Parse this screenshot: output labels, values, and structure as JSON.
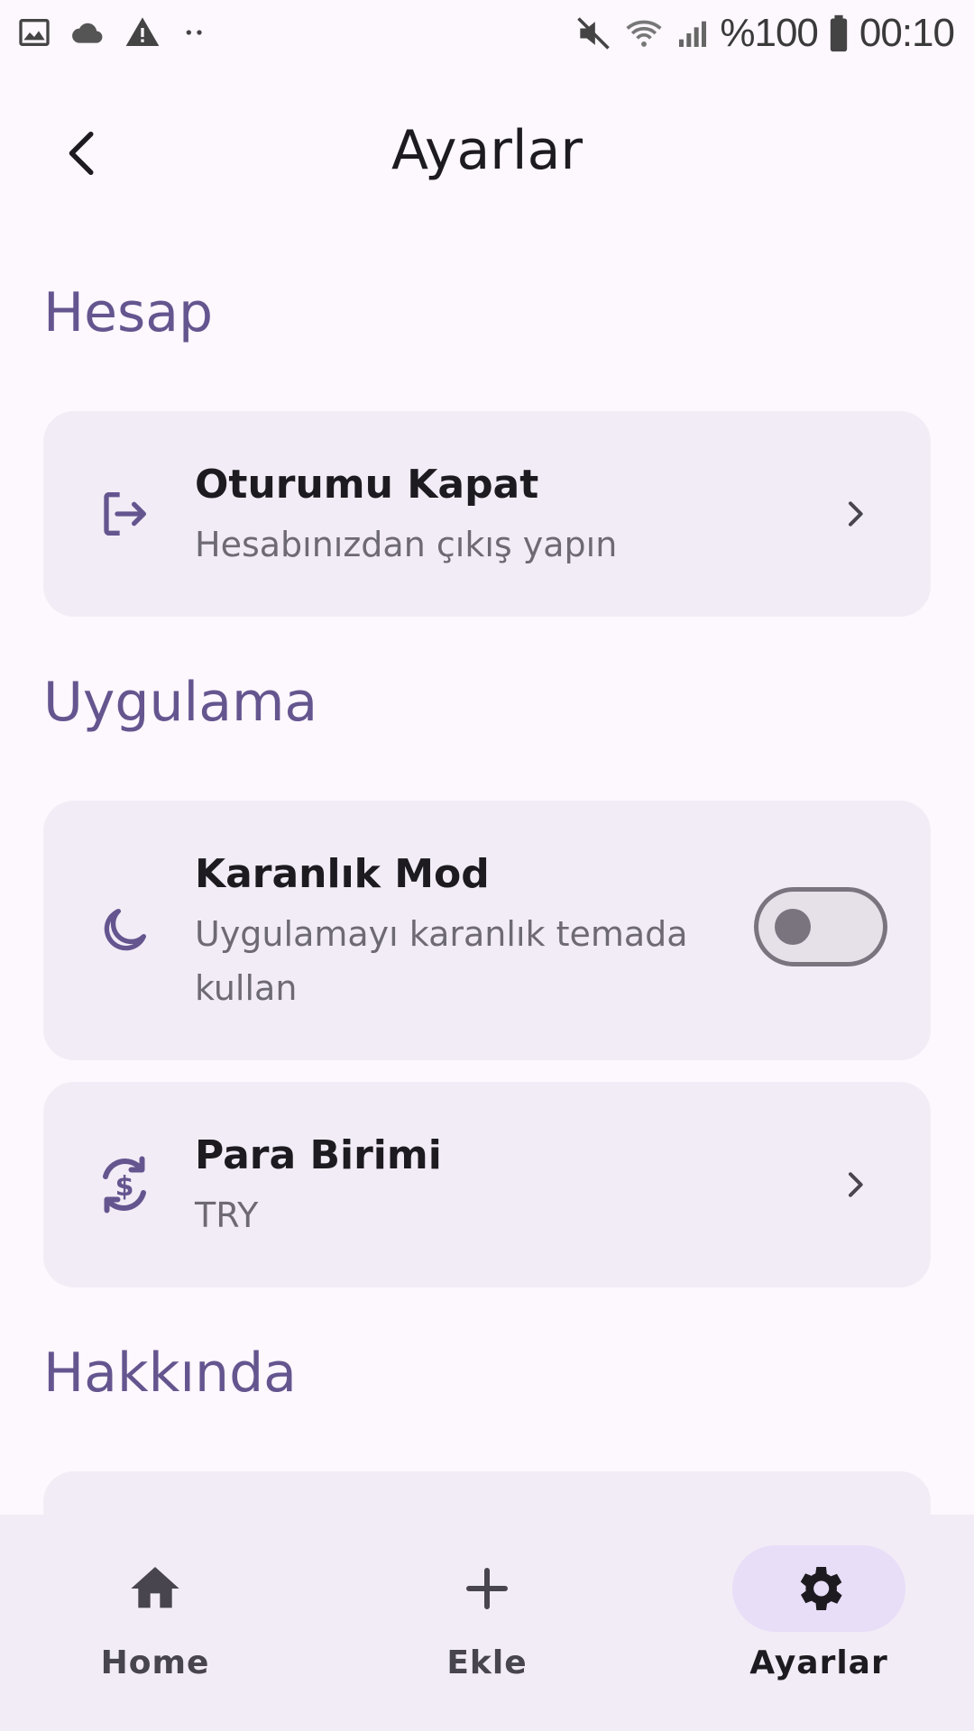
{
  "status_bar": {
    "battery_text": "%100",
    "time": "00:10"
  },
  "header": {
    "title": "Ayarlar"
  },
  "sections": {
    "account": {
      "title": "Hesap",
      "logout": {
        "title": "Oturumu Kapat",
        "subtitle": "Hesabınızdan çıkış yapın"
      }
    },
    "app": {
      "title": "Uygulama",
      "dark_mode": {
        "title": "Karanlık Mod",
        "subtitle": "Uygulamayı karanlık temada kullan",
        "enabled": false
      },
      "currency": {
        "title": "Para Birimi",
        "value": "TRY"
      }
    },
    "about": {
      "title": "Hakkında"
    }
  },
  "bottom_nav": {
    "items": [
      {
        "label": "Home",
        "icon": "home-icon",
        "active": false
      },
      {
        "label": "Ekle",
        "icon": "plus-icon",
        "active": false
      },
      {
        "label": "Ayarlar",
        "icon": "gear-icon",
        "active": true
      }
    ]
  },
  "colors": {
    "accent": "#65558f",
    "card_bg": "#f2ecf6",
    "background": "#fdf7fe",
    "active_pill": "#e8def8"
  }
}
